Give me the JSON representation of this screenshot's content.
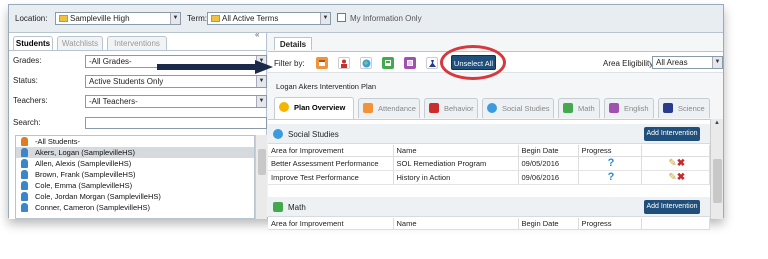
{
  "top": {
    "location_label": "Location:",
    "location_value": "Sampleville High",
    "term_label": "Term:",
    "term_value": "All Active Terms",
    "my_info_label": "My Information Only"
  },
  "left": {
    "collapse_glyph": "«",
    "tabs": [
      "Students",
      "Watchlists",
      "Interventions"
    ],
    "filters": {
      "grades_label": "Grades:",
      "grades_value": "-All Grades-",
      "status_label": "Status:",
      "status_value": "Active Students Only",
      "teachers_label": "Teachers:",
      "teachers_value": "-All Teachers-",
      "search_label": "Search:"
    },
    "students": [
      {
        "name": "-All Students-",
        "group": true,
        "selected": false
      },
      {
        "name": "Akers, Logan (SamplevilleHS)",
        "group": false,
        "selected": true
      },
      {
        "name": "Allen, Alexis (SamplevilleHS)",
        "group": false,
        "selected": false
      },
      {
        "name": "Brown, Frank (SamplevilleHS)",
        "group": false,
        "selected": false
      },
      {
        "name": "Cole, Emma (SamplevilleHS)",
        "group": false,
        "selected": false
      },
      {
        "name": "Cole, Jordan Morgan (SamplevilleHS)",
        "group": false,
        "selected": false
      },
      {
        "name": "Conner, Cameron (SamplevilleHS)",
        "group": false,
        "selected": false
      }
    ]
  },
  "right": {
    "details_tab": "Details",
    "filter_label": "Filter by:",
    "filter_icons": [
      {
        "name": "attendance-filter-icon",
        "color": "#f39237"
      },
      {
        "name": "behavior-filter-icon",
        "color": "#cc2e2e"
      },
      {
        "name": "social-studies-filter-icon",
        "color": "#3a9be0"
      },
      {
        "name": "math-filter-icon",
        "color": "#44a84c"
      },
      {
        "name": "english-filter-icon",
        "color": "#a050b0"
      },
      {
        "name": "science-filter-icon",
        "color": "#2a3a90"
      }
    ],
    "unselect_all": "Unselect All",
    "area_eligibility_label": "Area Eligibility:",
    "area_eligibility_value": "All Areas",
    "plan_title": "Logan Akers Intervention Plan",
    "plan_tabs": [
      "Plan Overview",
      "Attendance",
      "Behavior",
      "Social Studies",
      "Math",
      "English",
      "Science"
    ],
    "sections": [
      {
        "title": "Social Studies",
        "add_button": "Add Intervention",
        "columns": [
          "Area for Improvement",
          "Name",
          "Begin Date",
          "Progress",
          ""
        ],
        "rows": [
          {
            "area": "Better Assessment Performance",
            "name": "SOL Remediation Program",
            "date": "09/05/2016",
            "progress": "?"
          },
          {
            "area": "Improve Test Performance",
            "name": "History in Action",
            "date": "09/06/2016",
            "progress": "?"
          }
        ]
      },
      {
        "title": "Math",
        "add_button": "Add Intervention",
        "columns": [
          "Area for Improvement",
          "Name",
          "Begin Date",
          "Progress",
          ""
        ],
        "rows": []
      }
    ]
  },
  "colors": {
    "accent": "#1f4f7a",
    "highlight_ring": "#d8383c",
    "arrow": "#1b2a4a"
  }
}
